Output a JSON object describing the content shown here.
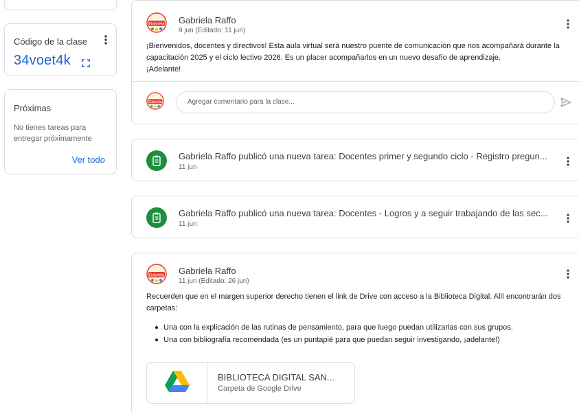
{
  "class_code": {
    "title": "Código de la clase",
    "value": "34voet4k"
  },
  "upcoming": {
    "title": "Próximas",
    "text": "No tienes tareas para entregar próximamente",
    "link": "Ver todo"
  },
  "posts": [
    {
      "author": "Gabriela Raffo",
      "date": "9 jun (Editado: 11 jun)",
      "lines": [
        "¡Bienvenidos, docentes y directivos! Esta aula virtual será nuestro puente de comunicación que nos acompañará durante la",
        "capacitación 2025 y el ciclo lectivo 2026. Es un placer acompañarlos en un nuevo desafío de aprendizaje.",
        "¡Adelante!"
      ],
      "comment_placeholder": "Agregar comentario para la clase..."
    }
  ],
  "tasks": [
    {
      "title": "Gabriela Raffo publicó una nueva tarea: Docentes primer y segundo ciclo - Registro pregun...",
      "date": "11 jun"
    },
    {
      "title": "Gabriela Raffo publicó una nueva tarea: Docentes - Logros y a seguir trabajando de las sec...",
      "date": "11 jun"
    }
  ],
  "post2": {
    "author": "Gabriela Raffo",
    "date": "11 jun (Editado: 26 jun)",
    "lines": [
      "Recuerden que en el margen superior derecho tienen el link de Drive con acceso a la Biblioteca Digital. Allí encontrarán dos",
      "carpetas:"
    ],
    "bullets": [
      "Una con la explicación de las rutinas de pensamiento, para que luego puedan utilizarlas con sus grupos.",
      "Una con bibliografía recomendada (es un puntapié para que puedan seguir investigando, ¡adelante!)"
    ],
    "attachment": {
      "title": "BIBLIOTECA DIGITAL SAN...",
      "subtitle": "Carpeta de Google Drive",
      "icon": "google-drive-icon"
    }
  },
  "avatar_text": "Gabriela",
  "colors": {
    "accent": "#1967d2",
    "task_green": "#1e8e3e",
    "border": "#dadce0"
  }
}
